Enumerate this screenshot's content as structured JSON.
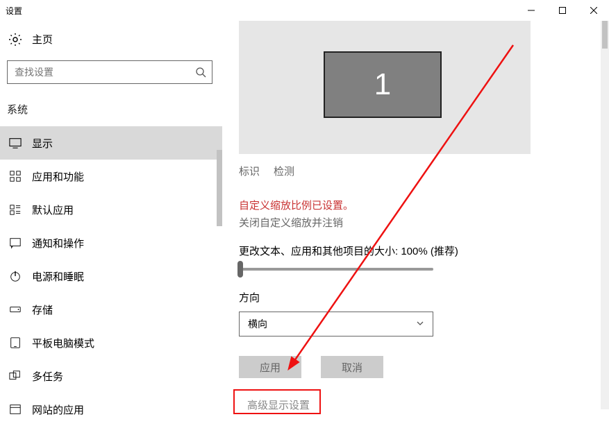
{
  "window": {
    "title": "设置"
  },
  "sidebar": {
    "home": "主页",
    "search_placeholder": "查找设置",
    "category": "系统",
    "items": [
      {
        "label": "显示"
      },
      {
        "label": "应用和功能"
      },
      {
        "label": "默认应用"
      },
      {
        "label": "通知和操作"
      },
      {
        "label": "电源和睡眠"
      },
      {
        "label": "存储"
      },
      {
        "label": "平板电脑模式"
      },
      {
        "label": "多任务"
      },
      {
        "label": "网站的应用"
      }
    ]
  },
  "main": {
    "monitor_number": "1",
    "identify": "标识",
    "detect": "检测",
    "scale_warning": "自定义缩放比例已设置。",
    "scale_close_link": "关闭自定义缩放并注销",
    "scale_label": "更改文本、应用和其他项目的大小: 100% (推荐)",
    "orientation_label": "方向",
    "orientation_value": "横向",
    "apply": "应用",
    "cancel": "取消",
    "advanced": "高级显示设置"
  }
}
